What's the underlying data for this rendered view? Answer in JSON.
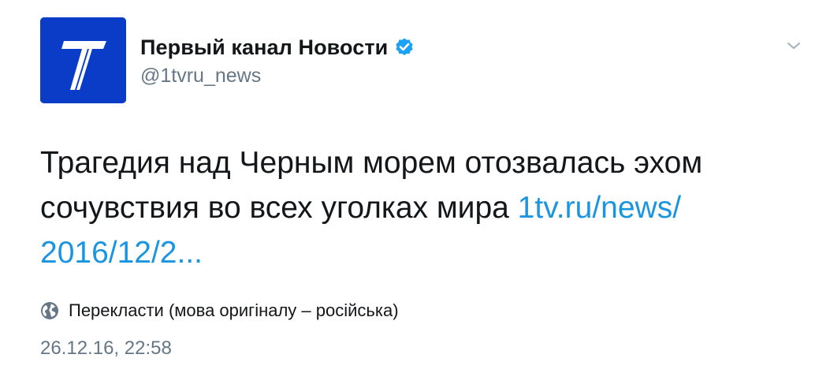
{
  "author": {
    "display_name": "Первый канал Новости",
    "handle": "@1tvru_news",
    "verified": true,
    "avatar_icon": "channel-one-logo",
    "avatar_color": "#0a3cc8"
  },
  "tweet": {
    "text": "Трагедия над Черным морем отозвалась эхом сочувствия во всех уголках мира",
    "link_line1": "1tv.ru/news/",
    "link_line2": "2016/12/2..."
  },
  "translate": {
    "label": "Перекласти (мова оригіналу – російська)",
    "icon": "globe-icon"
  },
  "timestamp": "26.12.16, 22:58",
  "colors": {
    "link": "#1b95e0",
    "verified": "#1da1f2",
    "secondary_text": "#657786"
  }
}
